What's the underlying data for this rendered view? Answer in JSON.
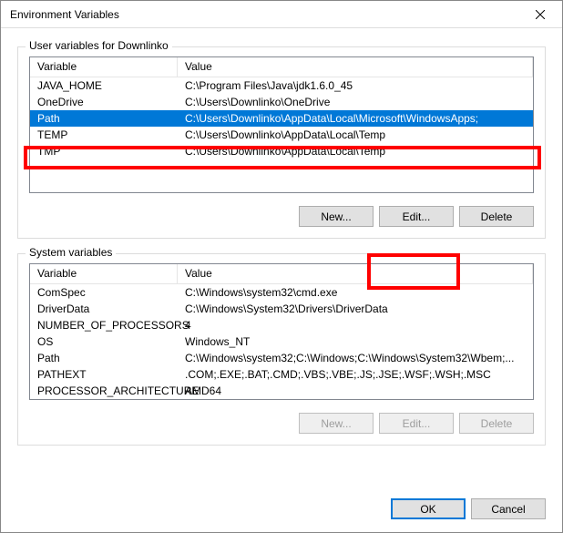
{
  "window": {
    "title": "Environment Variables"
  },
  "user_section": {
    "label": "User variables for Downlinko",
    "columns": {
      "variable": "Variable",
      "value": "Value"
    },
    "rows": [
      {
        "variable": "JAVA_HOME",
        "value": "C:\\Program Files\\Java\\jdk1.6.0_45"
      },
      {
        "variable": "OneDrive",
        "value": "C:\\Users\\Downlinko\\OneDrive"
      },
      {
        "variable": "Path",
        "value": "C:\\Users\\Downlinko\\AppData\\Local\\Microsoft\\WindowsApps;"
      },
      {
        "variable": "TEMP",
        "value": "C:\\Users\\Downlinko\\AppData\\Local\\Temp"
      },
      {
        "variable": "TMP",
        "value": "C:\\Users\\Downlinko\\AppData\\Local\\Temp"
      }
    ],
    "buttons": {
      "new": "New...",
      "edit": "Edit...",
      "delete": "Delete"
    }
  },
  "system_section": {
    "label": "System variables",
    "columns": {
      "variable": "Variable",
      "value": "Value"
    },
    "rows": [
      {
        "variable": "ComSpec",
        "value": "C:\\Windows\\system32\\cmd.exe"
      },
      {
        "variable": "DriverData",
        "value": "C:\\Windows\\System32\\Drivers\\DriverData"
      },
      {
        "variable": "NUMBER_OF_PROCESSORS",
        "value": "4"
      },
      {
        "variable": "OS",
        "value": "Windows_NT"
      },
      {
        "variable": "Path",
        "value": "C:\\Windows\\system32;C:\\Windows;C:\\Windows\\System32\\Wbem;..."
      },
      {
        "variable": "PATHEXT",
        "value": ".COM;.EXE;.BAT;.CMD;.VBS;.VBE;.JS;.JSE;.WSF;.WSH;.MSC"
      },
      {
        "variable": "PROCESSOR_ARCHITECTURE",
        "value": "AMD64"
      }
    ],
    "buttons": {
      "new": "New...",
      "edit": "Edit...",
      "delete": "Delete"
    }
  },
  "footer": {
    "ok": "OK",
    "cancel": "Cancel"
  }
}
